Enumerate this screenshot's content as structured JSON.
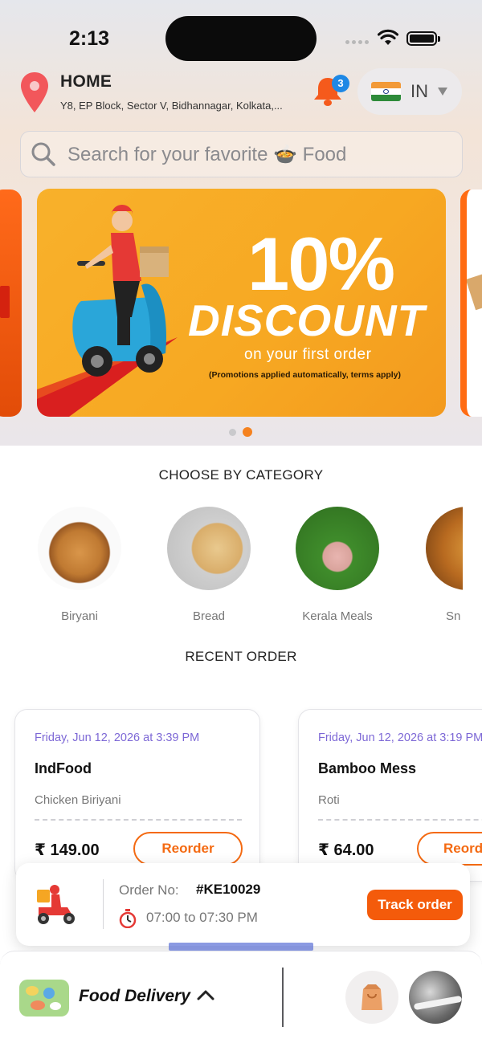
{
  "status_bar": {
    "time": "2:13"
  },
  "location": {
    "title": "HOME",
    "address": "Y8, EP Block, Sector V, Bidhannagar, Kolkata,..."
  },
  "notifications": {
    "count": "3"
  },
  "country": {
    "code": "IN"
  },
  "search": {
    "placeholder": "Search for your favorite 🍲 Food"
  },
  "banner": {
    "headline": "10%",
    "title": "DISCOUNT",
    "subtitle": "on your first order",
    "note": "(Promotions applied automatically, terms apply)"
  },
  "categories": {
    "title": "CHOOSE BY CATEGORY",
    "items": [
      {
        "label": "Biryani"
      },
      {
        "label": "Bread"
      },
      {
        "label": "Kerala Meals"
      },
      {
        "label": "Sn"
      }
    ]
  },
  "recent_orders": {
    "title": "RECENT ORDER",
    "items": [
      {
        "date": "Friday, Jun 12, 2026 at 3:39 PM",
        "restaurant": "IndFood",
        "item": "Chicken Biriyani",
        "price": "₹ 149.00",
        "button": "Reorder"
      },
      {
        "date": "Friday, Jun 12, 2026 at 3:19 PM",
        "restaurant": "Bamboo Mess",
        "item": "Roti",
        "price": "₹ 64.00",
        "button": "Reord"
      }
    ]
  },
  "tracking": {
    "order_label": "Order No:",
    "order_number": "#KE10029",
    "time_window": "07:00 to 07:30 PM",
    "button": "Track order"
  },
  "bottom_bar": {
    "mode_label": "Food Delivery"
  }
}
